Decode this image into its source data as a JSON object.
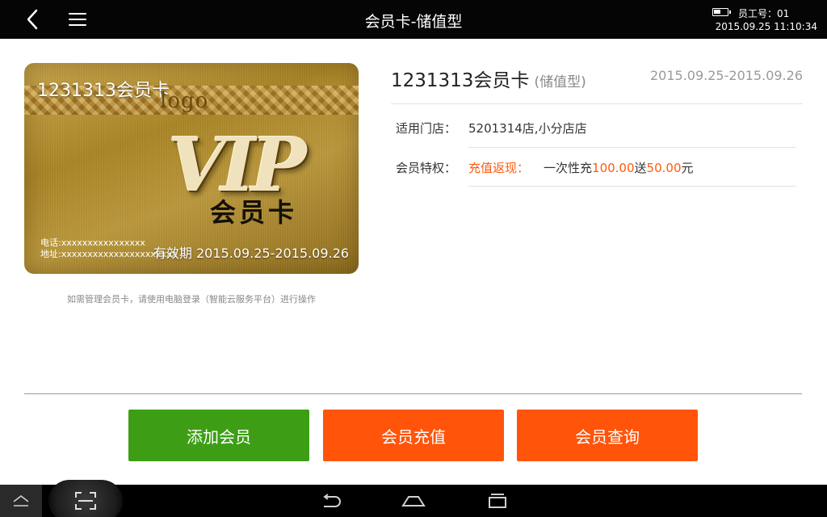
{
  "topbar": {
    "title": "会员卡-储值型",
    "employee": "员工号：01",
    "datetime": "2015.09.25 11:10:34"
  },
  "card": {
    "name": "1231313会员卡",
    "logo": "logo",
    "vip": "VIP",
    "type_label": "会员卡",
    "phone_line": "电话:xxxxxxxxxxxxxxxx",
    "address_line": "地址:xxxxxxxxxxxxxxxxxxxxxx",
    "validity": "有效期 2015.09.25-2015.09.26"
  },
  "manage_hint": "如需管理会员卡，请使用电脑登录（智能云服务平台）进行操作",
  "detail": {
    "title": "1231313会员卡",
    "type": "(储值型)",
    "date_range": "2015.09.25-2015.09.26",
    "store_label": "适用门店：",
    "store_value": "5201314店,小分店店",
    "privilege_label": "会员特权：",
    "privilege_type": "充值返现：",
    "privilege_prefix": "一次性充",
    "recharge_amount": "100.00",
    "privilege_middle": "送",
    "bonus_amount": "50.00",
    "privilege_suffix": "元"
  },
  "buttons": {
    "add_member": "添加会员",
    "recharge": "会员充值",
    "query": "会员查询"
  },
  "colors": {
    "green": "#3d9e15",
    "orange": "#ff540a",
    "accent_text": "#ff5a0f",
    "topbar": "#050505"
  },
  "icons": {
    "back": "back-arrow-icon",
    "menu": "hamburger-menu-icon",
    "battery": "battery-icon",
    "eject": "eject-icon",
    "scan": "scan-icon",
    "nav_back": "nav-back-icon",
    "home": "home-icon",
    "recents": "recents-icon"
  }
}
